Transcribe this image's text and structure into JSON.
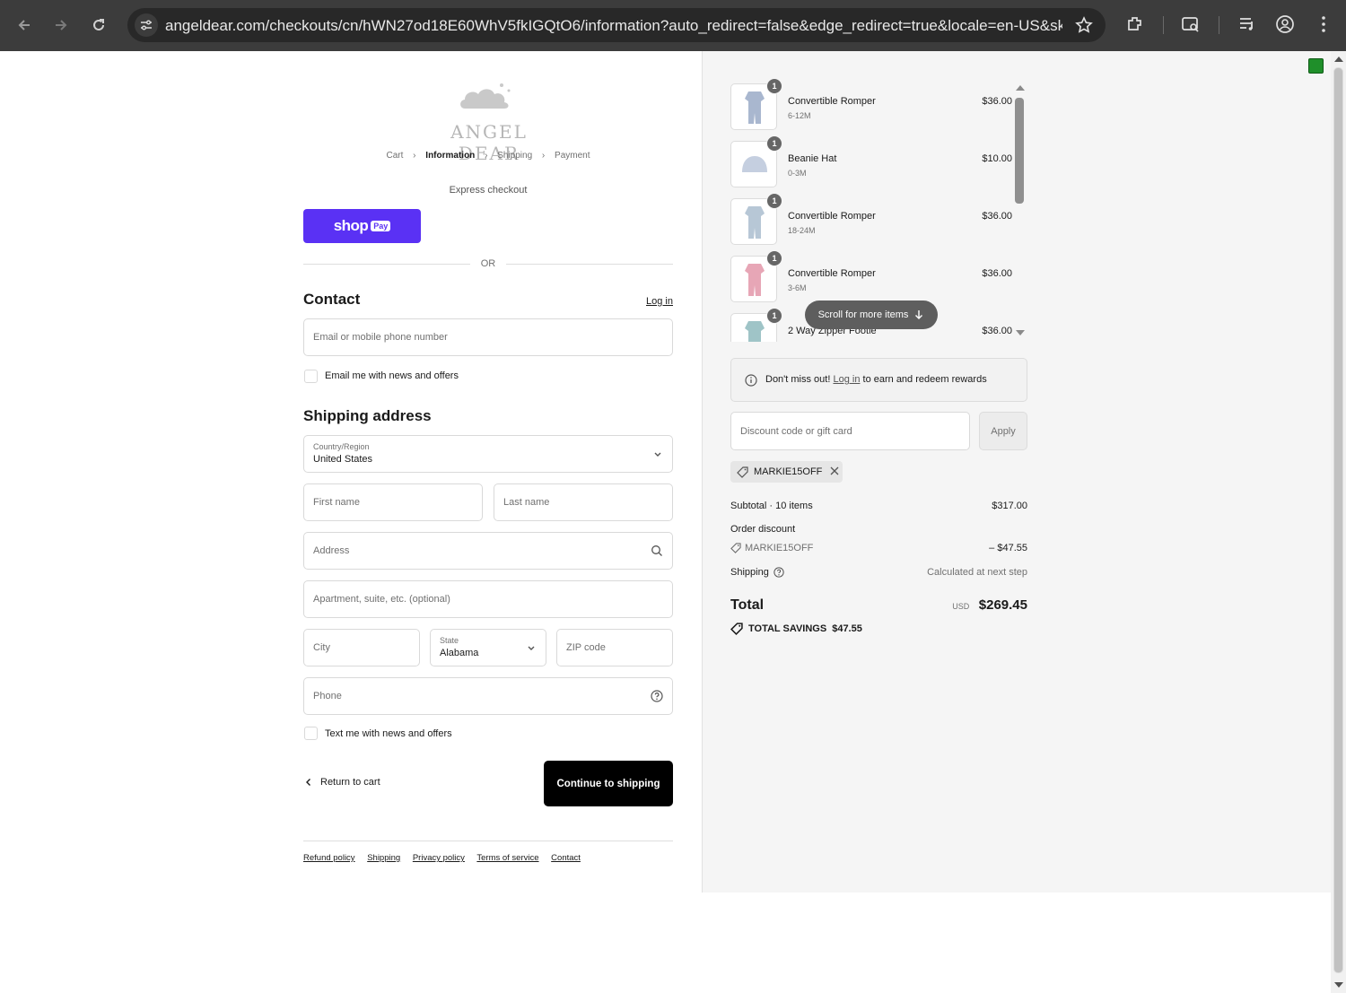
{
  "browser": {
    "url": "angeldear.com/checkouts/cn/hWN27od18E60WhV5fkIGQtO6/information?auto_redirect=false&edge_redirect=true&locale=en-US&ski..."
  },
  "store": {
    "logo_text": "ANGEL DEAR"
  },
  "breadcrumb": {
    "cart": "Cart",
    "information": "Information",
    "shipping": "Shipping",
    "payment": "Payment"
  },
  "express": {
    "label": "Express checkout",
    "shop": "shop",
    "pay": "Pay",
    "or": "OR"
  },
  "contact": {
    "heading": "Contact",
    "login": "Log in",
    "email_placeholder": "Email or mobile phone number",
    "news_label": "Email me with news and offers"
  },
  "shipping": {
    "heading": "Shipping address",
    "country_label": "Country/Region",
    "country_value": "United States",
    "first_name": "First name",
    "last_name": "Last name",
    "address": "Address",
    "apartment": "Apartment, suite, etc. (optional)",
    "city": "City",
    "state_label": "State",
    "state_value": "Alabama",
    "zip": "ZIP code",
    "phone": "Phone",
    "text_label": "Text me with news and offers"
  },
  "actions": {
    "return": "Return to cart",
    "continue": "Continue to shipping"
  },
  "footer": {
    "refund": "Refund policy",
    "shipping": "Shipping",
    "privacy": "Privacy policy",
    "terms": "Terms of service",
    "contact": "Contact"
  },
  "order": {
    "items": [
      {
        "qty": "1",
        "name": "Convertible Romper",
        "variant": "6-12M",
        "price": "$36.00",
        "color": "#a9b7cf"
      },
      {
        "qty": "1",
        "name": "Beanie Hat",
        "variant": "0-3M",
        "price": "$10.00",
        "color": "#c5cfe0"
      },
      {
        "qty": "1",
        "name": "Convertible Romper",
        "variant": "18-24M",
        "price": "$36.00",
        "color": "#b7c7d6"
      },
      {
        "qty": "1",
        "name": "Convertible Romper",
        "variant": "3-6M",
        "price": "$36.00",
        "color": "#e7a6b6"
      },
      {
        "qty": "1",
        "name": "2 Way Zipper Footie",
        "variant": "",
        "price": "$36.00",
        "color": "#9fc4c7"
      }
    ],
    "scroll_hint": "Scroll for more items",
    "rewards_prefix": "Don't miss out!",
    "rewards_link": "Log in",
    "rewards_suffix": "to earn and redeem rewards",
    "discount_placeholder": "Discount code or gift card",
    "apply": "Apply",
    "applied_code": "MARKIE15OFF",
    "subtotal_label": "Subtotal · 10 items",
    "subtotal_value": "$317.00",
    "discount_label": "Order discount",
    "discount_code": "MARKIE15OFF",
    "discount_value": "– $47.55",
    "shipping_label": "Shipping",
    "shipping_value": "Calculated at next step",
    "total_label": "Total",
    "total_currency": "USD",
    "total_value": "$269.45",
    "savings_label": "TOTAL SAVINGS",
    "savings_value": "$47.55"
  }
}
